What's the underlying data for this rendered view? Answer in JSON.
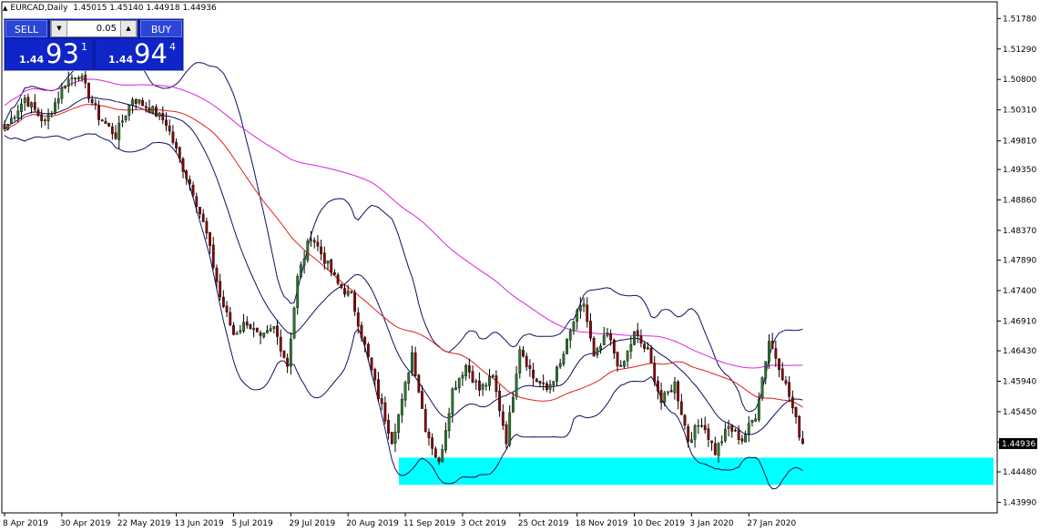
{
  "symbol_bar": {
    "marker": "▲",
    "title": "EURCAD,Daily",
    "ohlc": "1.45015 1.45140 1.44918 1.44936"
  },
  "trade_panel": {
    "sell_label": "SELL",
    "buy_label": "BUY",
    "lot": "0.05",
    "down_arrow": "▼",
    "up_arrow": "▲",
    "bid": {
      "small": "1.44",
      "big": "93",
      "sup": "1"
    },
    "ask": {
      "small": "1.44",
      "big": "94",
      "sup": "4"
    }
  },
  "colors": {
    "bull": "#2a7a2a",
    "bear": "#8b0000",
    "ma_red": "#e02020",
    "ma_magenta": "#dd22dd",
    "bands": "#101060",
    "zone": "#00ffff"
  },
  "chart_data": {
    "type": "candlestick",
    "symbol": "EURCAD",
    "timeframe": "Daily",
    "ylim": [
      1.4382,
      1.5205
    ],
    "y_ticks": [
      "1.51780",
      "1.51290",
      "1.50800",
      "1.50310",
      "1.49810",
      "1.49350",
      "1.48860",
      "1.48370",
      "1.47890",
      "1.47400",
      "1.46910",
      "1.46430",
      "1.45940",
      "1.45450",
      "1.44960",
      "1.44480",
      "1.43990"
    ],
    "x_labels": [
      "8 Apr 2019",
      "30 Apr 2019",
      "22 May 2019",
      "13 Jun 2019",
      "5 Jul 2019",
      "29 Jul 2019",
      "20 Aug 2019",
      "11 Sep 2019",
      "3 Oct 2019",
      "25 Oct 2019",
      "18 Nov 2019",
      "10 Dec 2019",
      "3 Jan 2020",
      "27 Jan 2020"
    ],
    "current_price": "1.44936",
    "grid": false,
    "support_zone": {
      "from": 1.4427,
      "to": 1.4471
    },
    "anchors": [
      {
        "i": 0,
        "c": 1.5
      },
      {
        "i": 6,
        "c": 1.505
      },
      {
        "i": 12,
        "c": 1.501
      },
      {
        "i": 18,
        "c": 1.5075
      },
      {
        "i": 22,
        "c": 1.509
      },
      {
        "i": 28,
        "c": 1.502
      },
      {
        "i": 33,
        "c": 1.499
      },
      {
        "i": 38,
        "c": 1.505
      },
      {
        "i": 44,
        "c": 1.503
      },
      {
        "i": 48,
        "c": 1.501
      },
      {
        "i": 52,
        "c": 1.495
      },
      {
        "i": 56,
        "c": 1.49
      },
      {
        "i": 60,
        "c": 1.483
      },
      {
        "i": 64,
        "c": 1.473
      },
      {
        "i": 68,
        "c": 1.467
      },
      {
        "i": 72,
        "c": 1.469
      },
      {
        "i": 76,
        "c": 1.466
      },
      {
        "i": 80,
        "c": 1.468
      },
      {
        "i": 84,
        "c": 1.462
      },
      {
        "i": 87,
        "c": 1.476
      },
      {
        "i": 91,
        "c": 1.483
      },
      {
        "i": 95,
        "c": 1.479
      },
      {
        "i": 99,
        "c": 1.475
      },
      {
        "i": 103,
        "c": 1.473
      },
      {
        "i": 107,
        "c": 1.465
      },
      {
        "i": 111,
        "c": 1.457
      },
      {
        "i": 115,
        "c": 1.45
      },
      {
        "i": 118,
        "c": 1.456
      },
      {
        "i": 121,
        "c": 1.464
      },
      {
        "i": 125,
        "c": 1.452
      },
      {
        "i": 129,
        "c": 1.446
      },
      {
        "i": 133,
        "c": 1.458
      },
      {
        "i": 137,
        "c": 1.462
      },
      {
        "i": 141,
        "c": 1.458
      },
      {
        "i": 145,
        "c": 1.46
      },
      {
        "i": 149,
        "c": 1.45
      },
      {
        "i": 153,
        "c": 1.465
      },
      {
        "i": 157,
        "c": 1.46
      },
      {
        "i": 161,
        "c": 1.458
      },
      {
        "i": 165,
        "c": 1.462
      },
      {
        "i": 169,
        "c": 1.469
      },
      {
        "i": 172,
        "c": 1.472
      },
      {
        "i": 175,
        "c": 1.463
      },
      {
        "i": 179,
        "c": 1.467
      },
      {
        "i": 183,
        "c": 1.461
      },
      {
        "i": 187,
        "c": 1.467
      },
      {
        "i": 191,
        "c": 1.464
      },
      {
        "i": 195,
        "c": 1.456
      },
      {
        "i": 199,
        "c": 1.459
      },
      {
        "i": 203,
        "c": 1.45
      },
      {
        "i": 207,
        "c": 1.453
      },
      {
        "i": 211,
        "c": 1.448
      },
      {
        "i": 215,
        "c": 1.452
      },
      {
        "i": 219,
        "c": 1.45
      },
      {
        "i": 223,
        "c": 1.454
      },
      {
        "i": 227,
        "c": 1.466
      },
      {
        "i": 230,
        "c": 1.462
      },
      {
        "i": 233,
        "c": 1.457
      },
      {
        "i": 236,
        "c": 1.451
      },
      {
        "i": 237,
        "c": 1.4494
      }
    ]
  }
}
